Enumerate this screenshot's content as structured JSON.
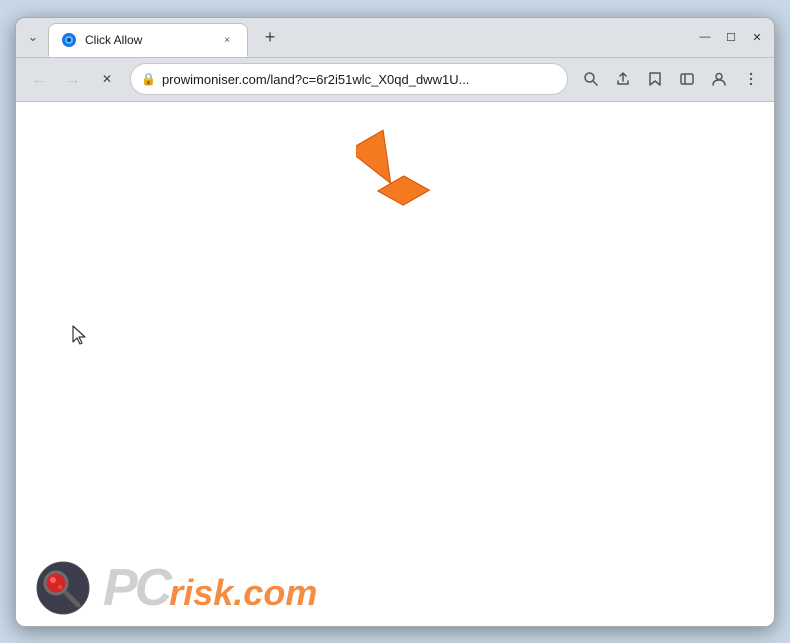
{
  "browser": {
    "tab": {
      "title": "Click Allow",
      "close_label": "×"
    },
    "new_tab_label": "+",
    "window_controls": {
      "minimize": "—",
      "maximize": "☐",
      "close": "✕",
      "chevron": "⌄"
    },
    "toolbar": {
      "back_label": "←",
      "forward_label": "→",
      "reload_label": "✕",
      "address": "prowimoniser.com/land?c=6r2i51wlc_X0qd_dww1U...",
      "lock_icon": "🔒",
      "search_icon": "🔍",
      "share_icon": "⎋",
      "bookmark_icon": "☆",
      "sidebar_icon": "▯",
      "profile_icon": "⊙",
      "menu_icon": "⋮"
    },
    "page": {
      "background": "#ffffff"
    }
  },
  "watermark": {
    "text_pc": "PC",
    "text_risk": "risk.com"
  },
  "cursor": {
    "symbol": "↖"
  }
}
